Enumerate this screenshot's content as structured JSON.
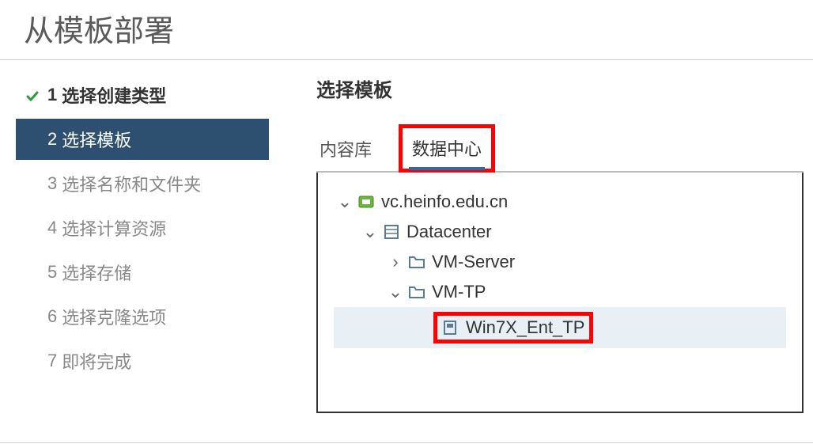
{
  "title": "从模板部署",
  "steps": [
    {
      "num": "1",
      "label": "选择创建类型",
      "status": "completed"
    },
    {
      "num": "2",
      "label": "选择模板",
      "status": "active"
    },
    {
      "num": "3",
      "label": "选择名称和文件夹",
      "status": "pending"
    },
    {
      "num": "4",
      "label": "选择计算资源",
      "status": "pending"
    },
    {
      "num": "5",
      "label": "选择存储",
      "status": "pending"
    },
    {
      "num": "6",
      "label": "选择克隆选项",
      "status": "pending"
    },
    {
      "num": "7",
      "label": "即将完成",
      "status": "pending"
    }
  ],
  "main": {
    "section_title": "选择模板",
    "tabs": [
      {
        "label": "内容库",
        "active": false
      },
      {
        "label": "数据中心",
        "active": true,
        "highlighted": true
      }
    ],
    "tree": [
      {
        "level": 0,
        "expanded": true,
        "icon": "vcenter",
        "label": "vc.heinfo.edu.cn"
      },
      {
        "level": 1,
        "expanded": true,
        "icon": "datacenter",
        "label": "Datacenter"
      },
      {
        "level": 2,
        "expanded": false,
        "icon": "folder",
        "label": "VM-Server"
      },
      {
        "level": 2,
        "expanded": true,
        "icon": "folder",
        "label": "VM-TP"
      },
      {
        "level": 3,
        "expanded": null,
        "icon": "template",
        "label": "Win7X_Ent_TP",
        "selected": true,
        "highlighted": true
      }
    ]
  }
}
